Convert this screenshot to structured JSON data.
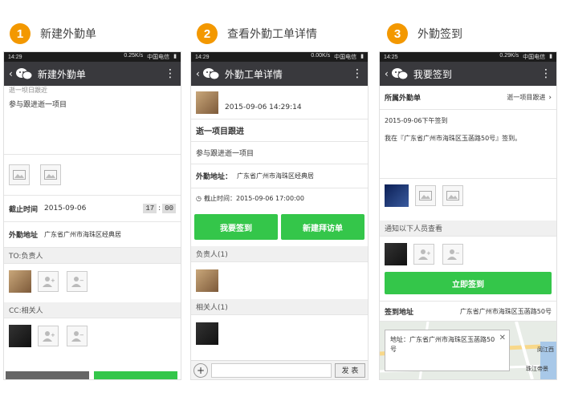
{
  "steps": [
    {
      "num": "1",
      "title": "新建外勤单"
    },
    {
      "num": "2",
      "title": "查看外勤工单详情"
    },
    {
      "num": "3",
      "title": "外勤签到"
    }
  ],
  "phone1": {
    "status": {
      "time": "14:29",
      "speed": "0.25K/s",
      "carrier": "中国电信"
    },
    "appbar_title": "新建外勤单",
    "cutoff_text": "逝一坝日跟近",
    "description": "参与跟进逝一项目",
    "deadline_label": "截止时间",
    "deadline_date": "2015-09-06",
    "deadline_hour": "17",
    "deadline_min": "00",
    "address_label": "外勤地址",
    "address_value": "广东省广州市海珠区经典居",
    "to_label": "TO:负责人",
    "cc_label": "CC:相关人"
  },
  "phone2": {
    "status": {
      "time": "14:29",
      "speed": "0.00K/s",
      "carrier": "中国电信"
    },
    "appbar_title": "外勤工单详情",
    "post_time": "2015-09-06 14:29:14",
    "project_title": "逝一项目跟进",
    "project_desc": "参与跟进逝一项目",
    "address_label": "外勤地址：",
    "address_value": "广东省广州市海珠区经典居",
    "deadline": "截止时间：2015-09-06 17:00:00",
    "btn_checkin": "我要签到",
    "btn_visit": "新建拜访单",
    "owner_label": "负责人(1)",
    "related_label": "相关人(1)",
    "send_label": "发 表"
  },
  "phone3": {
    "status": {
      "time": "14:25",
      "speed": "0.29K/s",
      "carrier": "中国电信"
    },
    "appbar_title": "我要签到",
    "order_label": "所属外勤单",
    "order_value": "逝一项目跟进",
    "checkin_time": "2015-09-06下午签到",
    "checkin_text": "我在『广东省广州市海珠区玉菡路50号』签到。",
    "notify_label": "通知以下人员查看",
    "btn_checkin": "立即签到",
    "addr_label": "签到地址",
    "addr_value": "广东省广州市海珠区玉菡路50号",
    "popup_text": "地址：广东省广州市海珠区玉菡路50号",
    "map_label1": "阅江西",
    "map_label2": "珠江帝景"
  },
  "colors": {
    "accent": "#f39800",
    "green": "#34c64a",
    "appbar": "#39393d"
  }
}
